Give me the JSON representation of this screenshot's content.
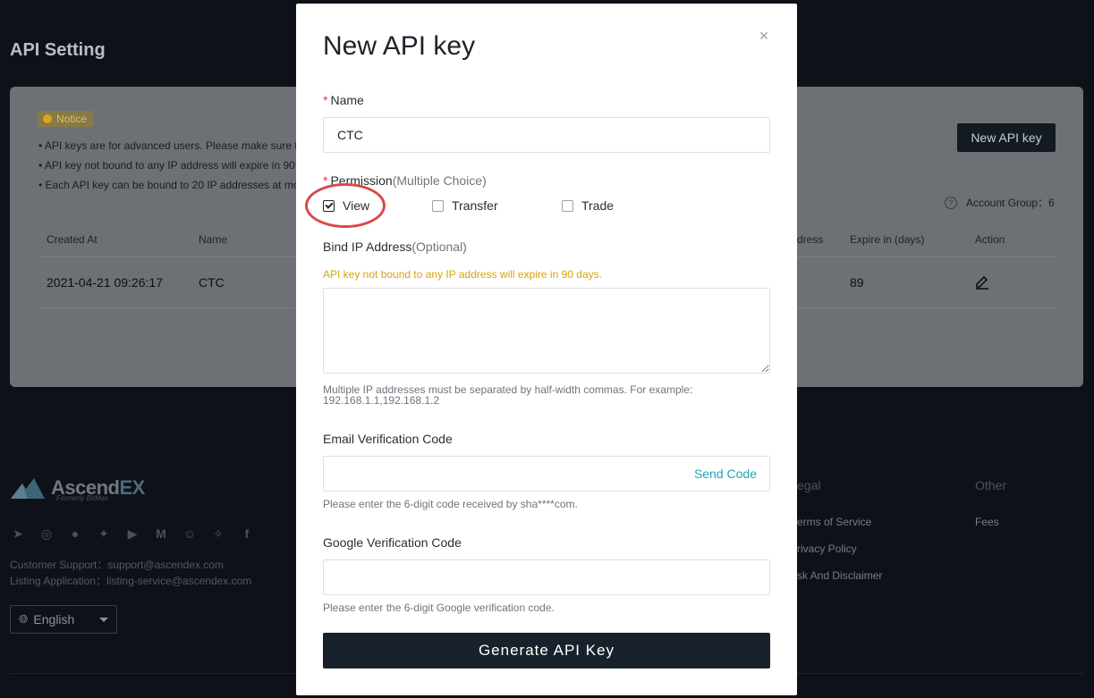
{
  "page": {
    "title": "API Setting",
    "notice": {
      "tag": "Notice",
      "lines": [
        "• API keys are for advanced users. Please make sure t",
        "• API key not bound to any IP address will expire in 90",
        "• Each API key can be bound to 20 IP addresses at mo"
      ]
    },
    "new_key_button": "New API key",
    "account_group": "Account Group：6",
    "table": {
      "headers": [
        "Created At",
        "Name",
        "dress",
        "Expire in (days)",
        "Action"
      ],
      "rows": [
        {
          "created_at": "2021-04-21 09:26:17",
          "name": "CTC",
          "expire_days": "89"
        }
      ]
    }
  },
  "footer": {
    "brand": "AscendEX",
    "brand_sub": "Formerly BitMax",
    "support": "Customer Support：support@ascendex.com",
    "listing": "Listing Application：listing-service@ascendex.com",
    "language": "English",
    "legal": {
      "title": "egal",
      "links": [
        "erms of Service",
        "rivacy Policy",
        "sk And Disclaimer"
      ]
    },
    "other": {
      "title": "Other",
      "links": [
        "Fees"
      ]
    },
    "socials": [
      "telegram-icon",
      "weibo-icon",
      "wechat-icon",
      "twitter-icon",
      "youtube-icon",
      "medium-icon",
      "reddit-icon",
      "discord-icon",
      "facebook-icon"
    ]
  },
  "modal": {
    "title": "New API key",
    "name_label": "Name",
    "name_value": "CTC",
    "permission_label": "Permission",
    "permission_sub": "(Multiple Choice)",
    "permissions": [
      {
        "label": "View",
        "checked": true
      },
      {
        "label": "Transfer",
        "checked": false
      },
      {
        "label": "Trade",
        "checked": false
      }
    ],
    "ip_label": "Bind IP Address",
    "ip_sub": "(Optional)",
    "ip_warning": "API key not bound to any IP address will expire in 90 days.",
    "ip_hint_1": "Multiple IP addresses must be separated by half-width commas. For example:",
    "ip_hint_2": "192.168.1.1,192.168.1.2",
    "email_label": "Email Verification Code",
    "send_code": "Send Code",
    "email_hint": "Please enter the 6-digit code received by sha****com.",
    "google_label": "Google Verification Code",
    "google_hint": "Please enter the 6-digit Google verification code.",
    "generate_button": "Generate API Key",
    "close_glyph": "×",
    "highlight_color": "#d84a4a"
  }
}
